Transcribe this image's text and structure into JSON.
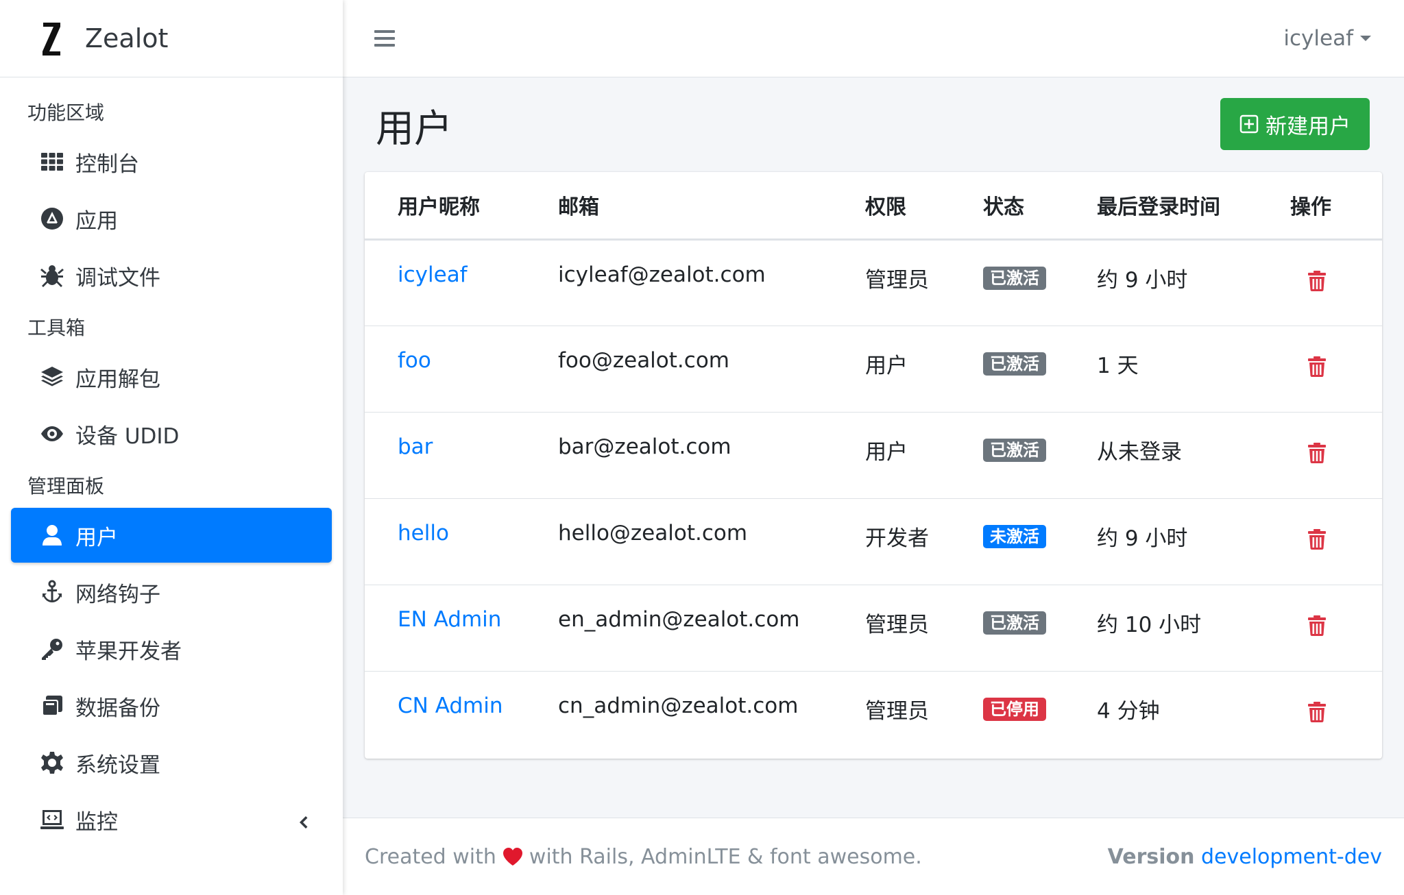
{
  "brand": {
    "logo_letter": "Z",
    "name": "Zealot"
  },
  "sidebar": {
    "sections": [
      {
        "header": "功能区域",
        "items": [
          {
            "label": "控制台",
            "icon": "grid-icon"
          },
          {
            "label": "应用",
            "icon": "app-store-icon"
          },
          {
            "label": "调试文件",
            "icon": "bug-icon"
          }
        ]
      },
      {
        "header": "工具箱",
        "items": [
          {
            "label": "应用解包",
            "icon": "layers-icon"
          },
          {
            "label": "设备 UDID",
            "icon": "eye-icon"
          }
        ]
      },
      {
        "header": "管理面板",
        "items": [
          {
            "label": "用户",
            "icon": "user-icon",
            "active": true
          },
          {
            "label": "网络钩子",
            "icon": "anchor-icon"
          },
          {
            "label": "苹果开发者",
            "icon": "key-icon"
          },
          {
            "label": "数据备份",
            "icon": "backup-icon"
          },
          {
            "label": "系统设置",
            "icon": "gear-icon"
          },
          {
            "label": "监控",
            "icon": "monitor-icon"
          }
        ]
      }
    ]
  },
  "topnav": {
    "user_name": "icyleaf"
  },
  "page": {
    "title": "用户",
    "new_button_label": "新建用户"
  },
  "table": {
    "headers": [
      "用户昵称",
      "邮箱",
      "权限",
      "状态",
      "最后登录时间",
      "操作"
    ],
    "rows": [
      {
        "name": "icyleaf",
        "email": "icyleaf@zealot.com",
        "role": "管理员",
        "status": "已激活",
        "status_color": "#6c757d",
        "last_login": "约 9 小时"
      },
      {
        "name": "foo",
        "email": "foo@zealot.com",
        "role": "用户",
        "status": "已激活",
        "status_color": "#6c757d",
        "last_login": "1 天"
      },
      {
        "name": "bar",
        "email": "bar@zealot.com",
        "role": "用户",
        "status": "已激活",
        "status_color": "#6c757d",
        "last_login": "从未登录"
      },
      {
        "name": "hello",
        "email": "hello@zealot.com",
        "role": "开发者",
        "status": "未激活",
        "status_color": "#007bff",
        "last_login": "约 9 小时"
      },
      {
        "name": "EN Admin",
        "email": "en_admin@zealot.com",
        "role": "管理员",
        "status": "已激活",
        "status_color": "#6c757d",
        "last_login": "约 10 小时"
      },
      {
        "name": "CN Admin",
        "email": "cn_admin@zealot.com",
        "role": "管理员",
        "status": "已停用",
        "status_color": "#dc3545",
        "last_login": "4 分钟"
      }
    ]
  },
  "footer": {
    "created_prefix": "Created with",
    "created_suffix": "with Rails, AdminLTE & font awesome.",
    "version_label": "Version",
    "version_value": "development-dev"
  },
  "colors": {
    "primary": "#007bff",
    "success": "#28a745",
    "danger": "#dc3545",
    "secondary": "#6c757d"
  }
}
